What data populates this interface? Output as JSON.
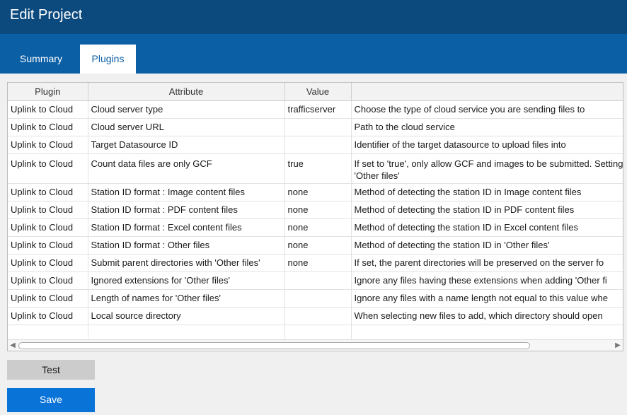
{
  "window": {
    "title": "Edit Project"
  },
  "tabs": [
    {
      "label": "Summary",
      "active": false
    },
    {
      "label": "Plugins",
      "active": true
    }
  ],
  "table": {
    "columns": [
      "Plugin",
      "Attribute",
      "Value",
      ""
    ],
    "rows": [
      {
        "plugin": "Uplink to Cloud",
        "attribute": "Cloud server type",
        "value": "trafficserver",
        "description": "Choose the type of cloud service you are sending files to"
      },
      {
        "plugin": "Uplink to Cloud",
        "attribute": "Cloud server URL",
        "value": "",
        "description": "Path to the cloud service"
      },
      {
        "plugin": "Uplink to Cloud",
        "attribute": "Target Datasource ID",
        "value": "",
        "description": "Identifier of the target datasource to upload files into"
      },
      {
        "plugin": "Uplink to Cloud",
        "attribute": "Count data files are only GCF",
        "value": "true",
        "description": "If set to 'true', only allow GCF and images to be submitted. Setting 'false' only allows 'Other files'"
      },
      {
        "plugin": "Uplink to Cloud",
        "attribute": "Station ID format : Image content files",
        "value": "none",
        "description": "Method of detecting the station ID in Image content files"
      },
      {
        "plugin": "Uplink to Cloud",
        "attribute": "Station ID format : PDF content files",
        "value": "none",
        "description": "Method of detecting the station ID in PDF content files"
      },
      {
        "plugin": "Uplink to Cloud",
        "attribute": "Station ID format : Excel content files",
        "value": "none",
        "description": "Method of detecting the station ID in Excel content files"
      },
      {
        "plugin": "Uplink to Cloud",
        "attribute": "Station ID format : Other files",
        "value": "none",
        "description": "Method of detecting the station ID in 'Other files'"
      },
      {
        "plugin": "Uplink to Cloud",
        "attribute": "Submit parent directories with 'Other files'",
        "value": "none",
        "description": "If set, the parent directories will be preserved on the server fo"
      },
      {
        "plugin": "Uplink to Cloud",
        "attribute": "Ignored extensions for 'Other files'",
        "value": "",
        "description": "Ignore any files having these extensions when adding 'Other fi"
      },
      {
        "plugin": "Uplink to Cloud",
        "attribute": "Length of names for 'Other files'",
        "value": "",
        "description": "Ignore any files with a name length not equal to this value whe"
      },
      {
        "plugin": "Uplink to Cloud",
        "attribute": "Local source directory",
        "value": "",
        "description": "When selecting new files to add, which directory should open"
      }
    ]
  },
  "buttons": {
    "test": "Test",
    "save": "Save"
  },
  "colors": {
    "titlebar": "#0c4a7e",
    "tabbar": "#0b5fa5",
    "save_button": "#0a73d8",
    "test_button": "#cccccc"
  }
}
